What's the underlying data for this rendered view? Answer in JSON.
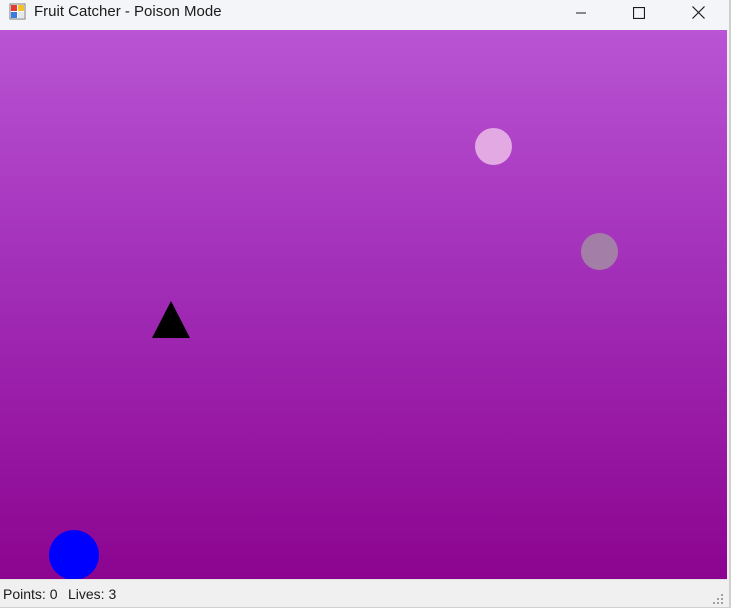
{
  "window": {
    "title": "Fruit Catcher - Poison Mode",
    "controls": {
      "minimize": "minimize-icon",
      "maximize": "maximize-icon",
      "close": "close-icon"
    }
  },
  "game": {
    "background_top": "#b954d4",
    "background_bottom": "#8c0490",
    "objects": [
      {
        "name": "falling-fruit-pink",
        "shape": "circle",
        "color": "#e3a9e3"
      },
      {
        "name": "falling-fruit-grey",
        "shape": "circle",
        "color": "#a37fa7"
      },
      {
        "name": "poison-object",
        "shape": "triangle",
        "color": "#000000"
      },
      {
        "name": "player-catcher",
        "shape": "circle",
        "color": "#0000ff"
      }
    ]
  },
  "status": {
    "points": "Points: 0",
    "lives": "Lives: 3"
  }
}
